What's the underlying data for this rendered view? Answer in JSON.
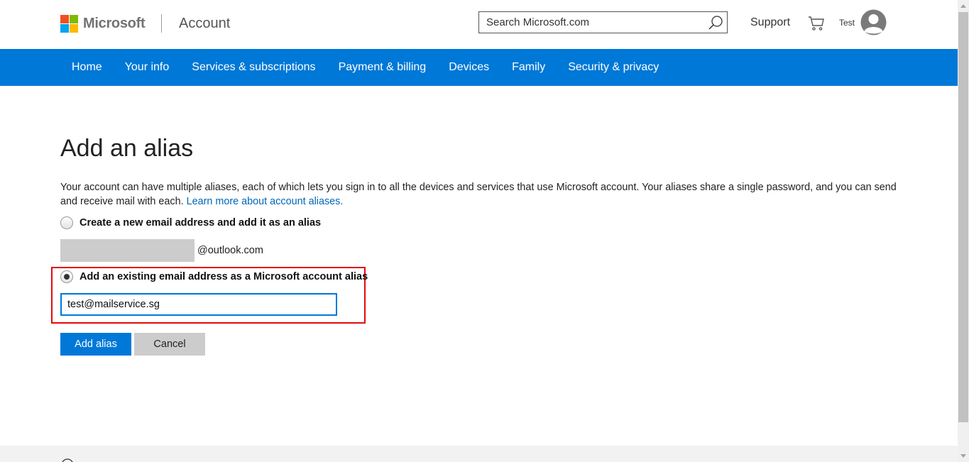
{
  "header": {
    "brand": "Microsoft",
    "product": "Account",
    "search_placeholder": "Search Microsoft.com",
    "support_label": "Support",
    "user_name": "Test"
  },
  "nav": {
    "items": [
      {
        "label": "Home"
      },
      {
        "label": "Your info"
      },
      {
        "label": "Services & subscriptions"
      },
      {
        "label": "Payment & billing"
      },
      {
        "label": "Devices"
      },
      {
        "label": "Family"
      },
      {
        "label": "Security & privacy"
      }
    ]
  },
  "main": {
    "title": "Add an alias",
    "description": "Your account can have multiple aliases, each of which lets you sign in to all the devices and services that use Microsoft account. Your aliases share a single password, and you can send and receive mail with each.",
    "learn_more_link": "Learn more about account aliases.",
    "option_new_label": "Create a new email address and add it as an alias",
    "new_alias_value": "",
    "domain_suffix": "@outlook.com",
    "option_existing_label": "Add an existing email address as a Microsoft account alias",
    "existing_email_value": "test@mailservice.sg",
    "selected_option": "existing",
    "add_button_label": "Add alias",
    "cancel_button_label": "Cancel"
  },
  "icons": {
    "logo": "microsoft-logo",
    "search": "search-icon",
    "cart": "cart-icon",
    "avatar": "avatar-icon",
    "globe": "globe-icon"
  },
  "colors": {
    "nav_background": "#0078d7",
    "primary_button": "#0078d7",
    "link": "#0067b8",
    "highlight_border": "#e00b0b",
    "logo_red": "#f25022",
    "logo_green": "#7fba00",
    "logo_blue": "#00a4ef",
    "logo_yellow": "#ffb900"
  }
}
